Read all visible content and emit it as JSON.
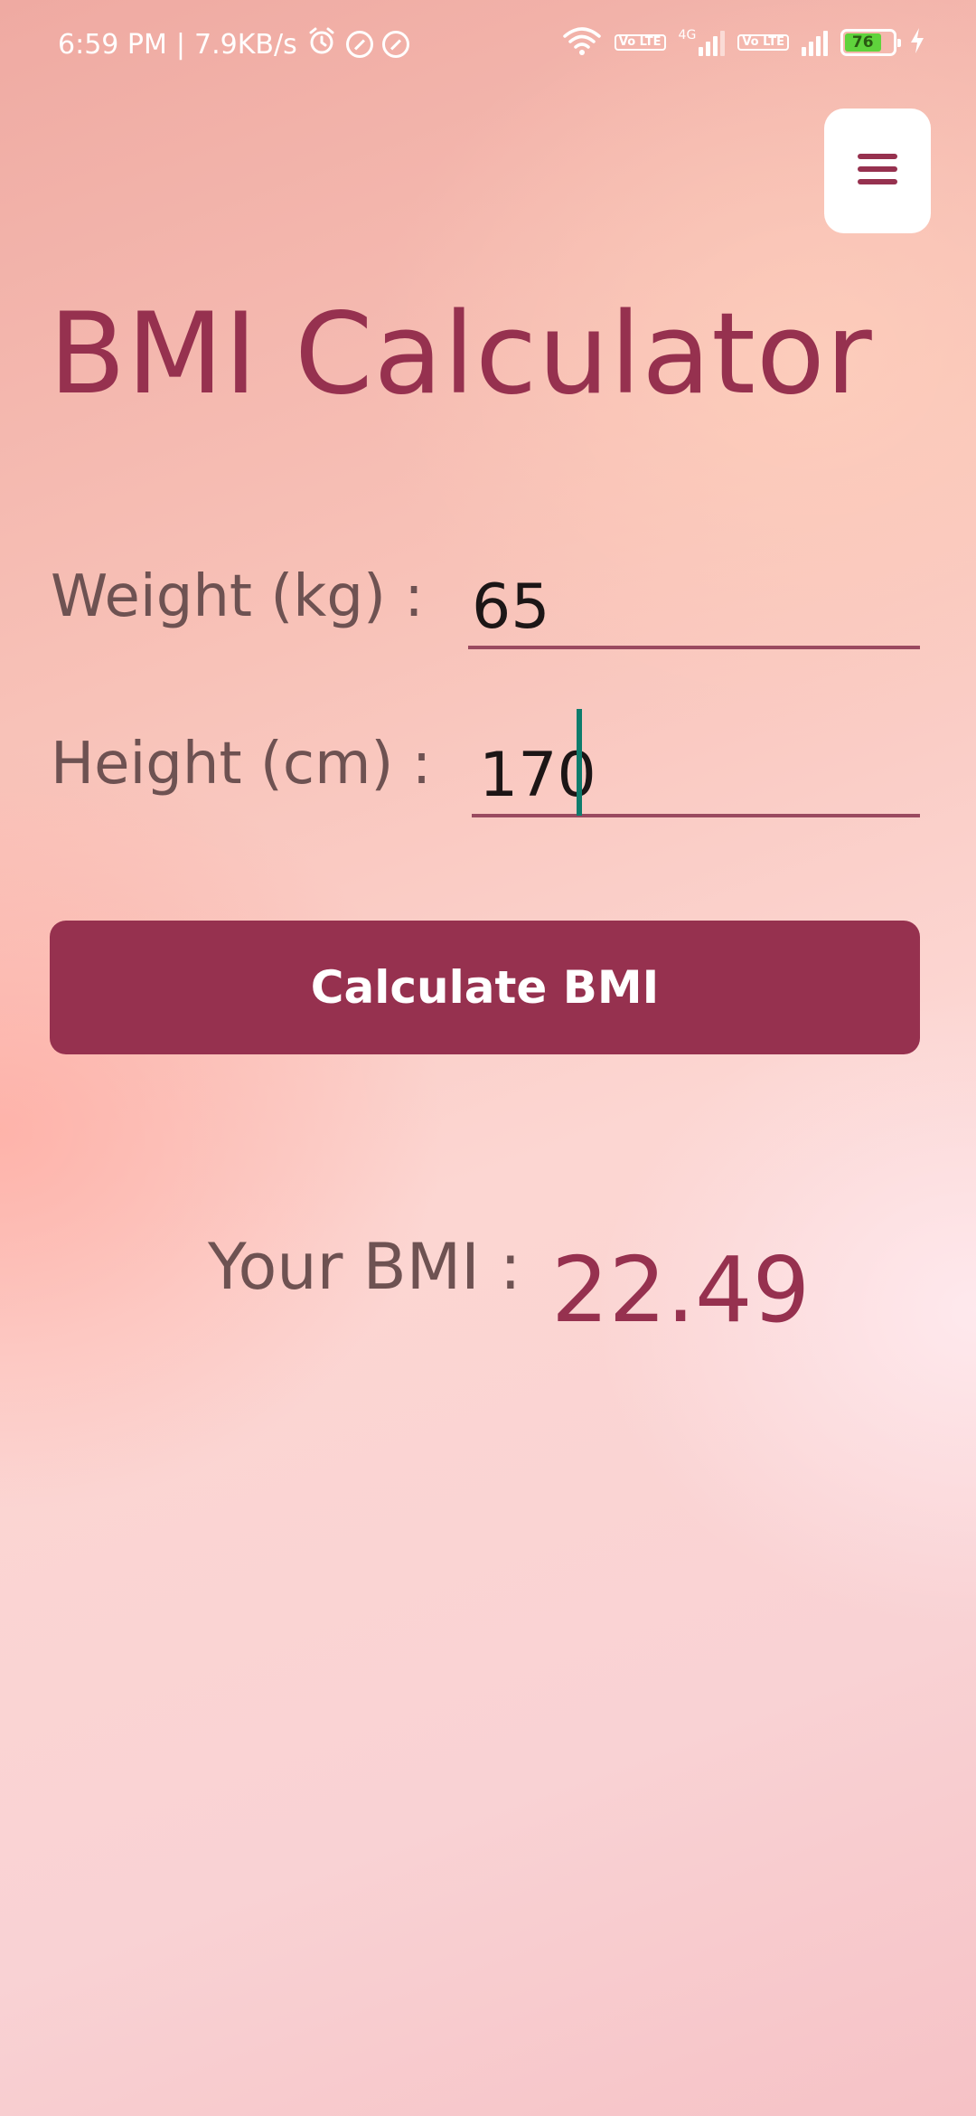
{
  "status_bar": {
    "time": "6:59 PM",
    "separator": "|",
    "network_speed": "7.9KB/s",
    "sim1_badge": "Vo LTE",
    "sim2_badge": "Vo LTE",
    "network_type": "4G",
    "battery_level": "76",
    "icons": [
      "alarm-icon",
      "no-disturb-icon",
      "no-disturb-icon",
      "wifi-icon",
      "signal-icon",
      "battery-icon",
      "charging-icon"
    ]
  },
  "header": {
    "menu_icon": "hamburger-menu-icon"
  },
  "title": "BMI Calculator",
  "form": {
    "weight_label": "Weight (kg) :",
    "weight_value": "65",
    "height_label": "Height (cm) :",
    "height_value": "170"
  },
  "calculate_button": {
    "label": "Calculate BMI"
  },
  "result": {
    "label": "Your BMI :",
    "value": "22.49"
  },
  "colors": {
    "accent": "#96314f",
    "label": "#6e5252",
    "caret": "#0d7c6c",
    "battery": "#5fd33c"
  }
}
